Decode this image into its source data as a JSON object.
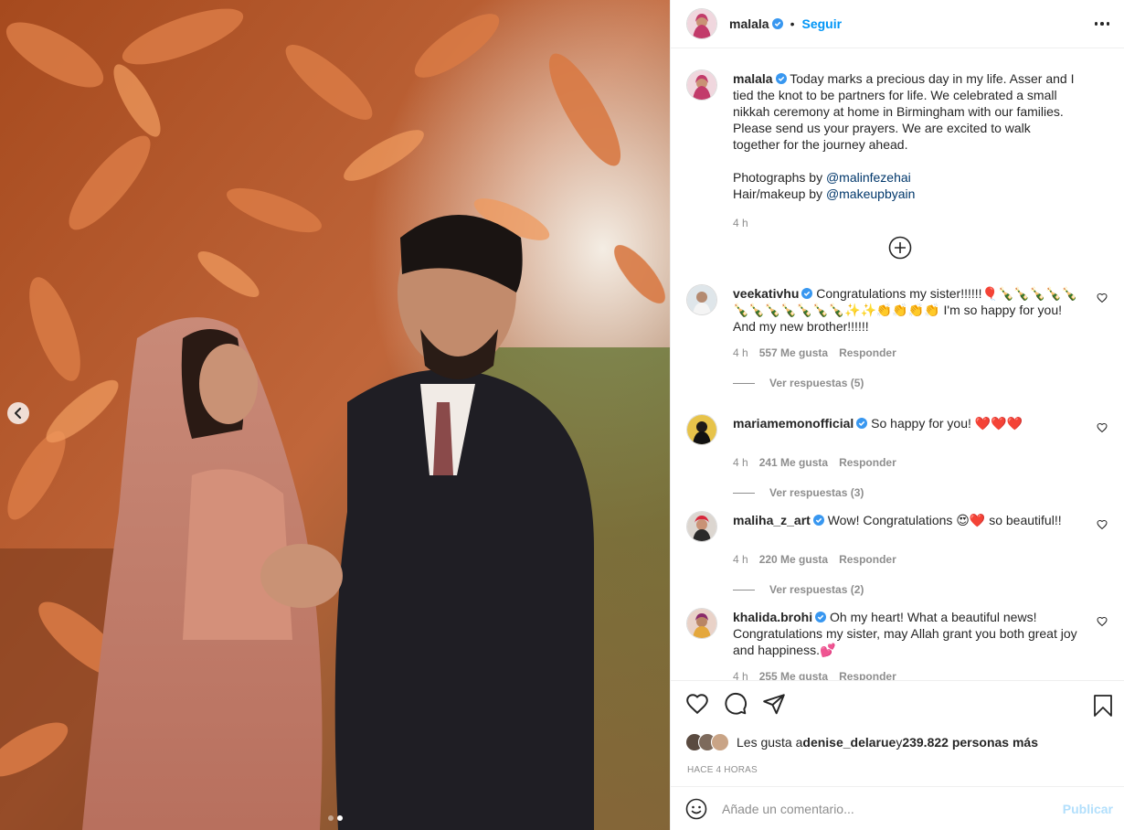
{
  "colors": {
    "accent": "#0095f6",
    "text": "#262626",
    "muted": "#8e8e8e",
    "link": "#00376b",
    "publish_disabled": "#b2dffc"
  },
  "post": {
    "author": "malala",
    "follow_label": "Seguir",
    "dot_separator": "•",
    "caption": {
      "username": "malala",
      "text": "Today marks a precious day in my life. Asser and I tied the knot to be partners for life. We celebrated a small nikkah ceremony at home in Birmingham with our families. Please send us your prayers. We are excited to walk together for the journey ahead.",
      "photographs_prefix": "Photographs by ",
      "photographs_handle": "@malinfezehai",
      "hair_prefix": "Hair/makeup by ",
      "hair_handle": "@makeupbyain",
      "time": "4 h"
    },
    "comments": [
      {
        "username": "veekativhu",
        "text": "Congratulations my sister!!!!!!🎈🍾🍾🍾🍾🍾🍾🍾🍾🍾🍾🍾🍾✨✨👏👏👏👏 I'm so happy for you! And my new brother!!!!!!",
        "time": "4 h",
        "likes": "557 Me gusta",
        "reply": "Responder",
        "view_replies": "Ver respuestas (5)"
      },
      {
        "username": "mariamemonofficial",
        "text": "So happy for you! ❤️❤️❤️",
        "time": "4 h",
        "likes": "241 Me gusta",
        "reply": "Responder",
        "view_replies": "Ver respuestas (3)"
      },
      {
        "username": "maliha_z_art",
        "text": "Wow! Congratulations 😍❤️ so beautiful!!",
        "time": "4 h",
        "likes": "220 Me gusta",
        "reply": "Responder",
        "view_replies": "Ver respuestas (2)"
      },
      {
        "username": "khalida.brohi",
        "text": "Oh my heart! What a beautiful news! Congratulations my sister, may Allah grant you both great joy and happiness.💕",
        "time": "4 h",
        "likes": "255 Me gusta",
        "reply": "Responder"
      }
    ],
    "likes_prefix": "Les gusta a ",
    "likes_user": "denise_delarue",
    "likes_mid": " y ",
    "likes_count": "239.822 personas más",
    "timestamp": "HACE 4 HORAS",
    "add_comment_placeholder": "Añade un comentario...",
    "publish_label": "Publicar",
    "carousel": {
      "total": 2,
      "active": 2
    }
  },
  "icons": [
    "verified-icon",
    "more-options-icon",
    "add-circle-icon",
    "heart-icon",
    "comment-icon",
    "share-icon",
    "bookmark-icon",
    "emoji-icon",
    "chevron-left-icon"
  ]
}
